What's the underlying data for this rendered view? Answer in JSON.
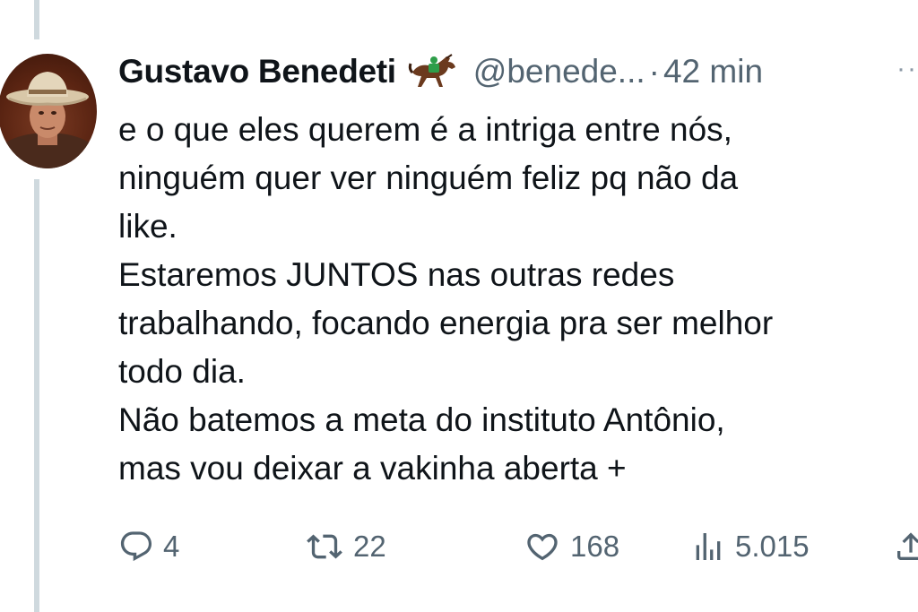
{
  "tweet": {
    "author_name": "Gustavo Benedeti",
    "author_emoji_icon": "horse-racing-icon",
    "handle": "@benede...",
    "separator": "·",
    "time": "42 min",
    "more_icon": "more-dots-icon",
    "paragraphs": [
      "e o que eles querem é a intriga entre nós, ninguém quer ver ninguém feliz pq não da like.",
      "Estaremos JUNTOS nas outras redes trabalhando, focando energia pra ser melhor todo dia.",
      "Não batemos a meta do instituto Antônio, mas vou deixar a vakinha aberta +"
    ],
    "lines": [
      "e o que eles querem é a intriga entre nós,",
      "ninguém quer ver ninguém feliz pq não da",
      "like.",
      "Estaremos JUNTOS nas outras redes",
      "trabalhando, focando energia pra ser melhor",
      "todo dia.",
      "Não batemos a meta do instituto Antônio,",
      "mas vou deixar a vakinha aberta +"
    ],
    "actions": {
      "reply": {
        "icon": "reply-icon",
        "count": "4"
      },
      "retweet": {
        "icon": "retweet-icon",
        "count": "22"
      },
      "like": {
        "icon": "heart-icon",
        "count": "168"
      },
      "views": {
        "icon": "views-chart-icon",
        "count": "5.015"
      },
      "share": {
        "icon": "share-icon"
      }
    }
  },
  "colors": {
    "text_primary": "#0f1419",
    "text_secondary": "#536471",
    "thread_line": "#cfd9de",
    "background": "#ffffff"
  }
}
